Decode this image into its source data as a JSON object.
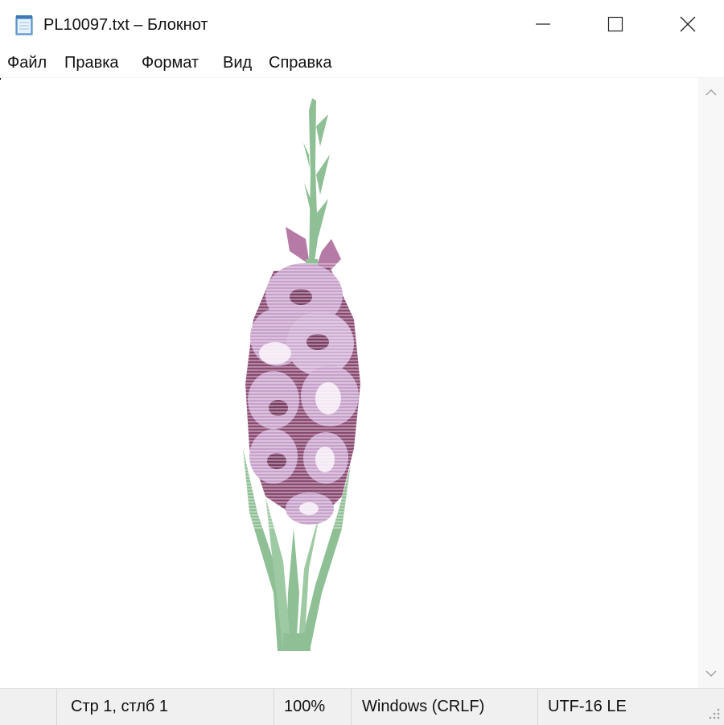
{
  "window": {
    "title": "PL10097.txt – Блокнот"
  },
  "menu": {
    "items": [
      "Файл",
      "Правка",
      "Формат",
      "Вид",
      "Справка"
    ]
  },
  "editor": {
    "content_image": "gladiolus-flower-ascii-art",
    "colors": {
      "petal": "#c7a1cb",
      "petal_dark": "#7a3d64",
      "stem": "#8fbf95",
      "white": "#ffffff"
    }
  },
  "status": {
    "position": "Стр 1, стлб 1",
    "zoom": "100%",
    "line_endings": "Windows (CRLF)",
    "encoding": "UTF-16 LE"
  }
}
